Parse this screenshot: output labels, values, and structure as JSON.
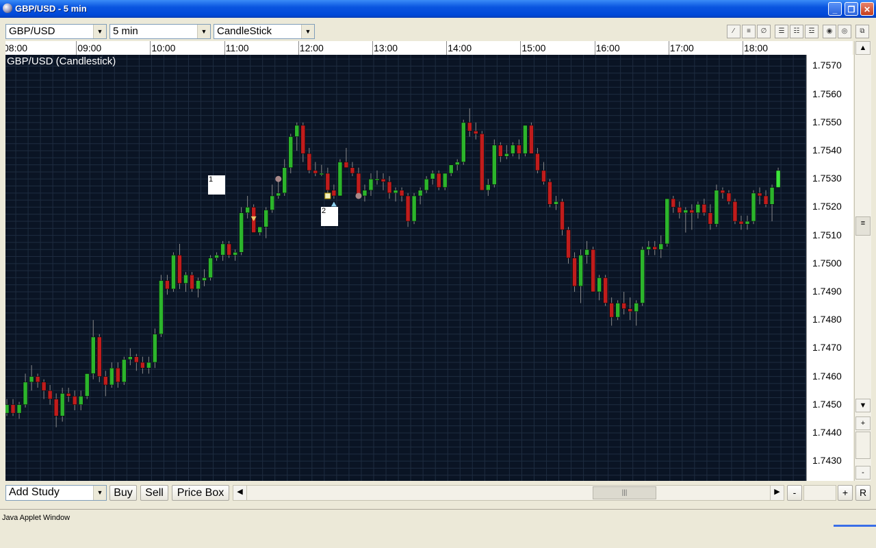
{
  "window": {
    "title": "GBP/USD - 5 min"
  },
  "toolbar": {
    "symbol": "GBP/USD",
    "interval": "5 min",
    "chart_type": "CandleStick"
  },
  "bottom": {
    "add_study": "Add Study",
    "buy": "Buy",
    "sell": "Sell",
    "price_box": "Price Box",
    "reset": "R",
    "zoom_out": "-",
    "zoom_in": "+"
  },
  "status": {
    "text": "Java Applet Window"
  },
  "notes": [
    "1",
    "2"
  ],
  "colors": {
    "background": "#0a1424",
    "up": "#2cb52c",
    "down": "#c01c1c",
    "grid": "#1e2c40"
  },
  "chart_data": {
    "type": "candlestick",
    "title": "GBP/USD (Candlestick)",
    "x_ticks": [
      "08:00",
      "09:00",
      "10:00",
      "11:00",
      "12:00",
      "13:00",
      "14:00",
      "15:00",
      "16:00",
      "17:00",
      "18:00"
    ],
    "y_ticks": [
      "1.7570",
      "1.7560",
      "1.7550",
      "1.7540",
      "1.7530",
      "1.7520",
      "1.7510",
      "1.7500",
      "1.7490",
      "1.7480",
      "1.7470",
      "1.7460",
      "1.7450",
      "1.7440",
      "1.7430"
    ],
    "ylim": [
      1.7423,
      1.7574
    ],
    "grid": true,
    "series": [
      {
        "time": "08:00",
        "open": 1.7447,
        "high": 1.7452,
        "low": 1.7446,
        "close": 1.745
      },
      {
        "time": "08:05",
        "open": 1.745,
        "high": 1.7452,
        "low": 1.7446,
        "close": 1.7447
      },
      {
        "time": "08:10",
        "open": 1.7447,
        "high": 1.7451,
        "low": 1.7445,
        "close": 1.745
      },
      {
        "time": "08:15",
        "open": 1.745,
        "high": 1.7461,
        "low": 1.7449,
        "close": 1.7458
      },
      {
        "time": "08:20",
        "open": 1.7458,
        "high": 1.7464,
        "low": 1.7455,
        "close": 1.746
      },
      {
        "time": "08:25",
        "open": 1.746,
        "high": 1.7461,
        "low": 1.7456,
        "close": 1.7458
      },
      {
        "time": "08:30",
        "open": 1.7458,
        "high": 1.7459,
        "low": 1.7452,
        "close": 1.7455
      },
      {
        "time": "08:35",
        "open": 1.7455,
        "high": 1.7457,
        "low": 1.745,
        "close": 1.7452
      },
      {
        "time": "08:40",
        "open": 1.7452,
        "high": 1.7454,
        "low": 1.7442,
        "close": 1.7446
      },
      {
        "time": "08:45",
        "open": 1.7446,
        "high": 1.7456,
        "low": 1.7444,
        "close": 1.7454
      },
      {
        "time": "08:50",
        "open": 1.7454,
        "high": 1.7456,
        "low": 1.7451,
        "close": 1.7453
      },
      {
        "time": "08:55",
        "open": 1.7453,
        "high": 1.7455,
        "low": 1.7448,
        "close": 1.745
      },
      {
        "time": "09:00",
        "open": 1.745,
        "high": 1.7455,
        "low": 1.7448,
        "close": 1.7453
      },
      {
        "time": "09:05",
        "open": 1.7453,
        "high": 1.7461,
        "low": 1.7452,
        "close": 1.7461
      },
      {
        "time": "09:10",
        "open": 1.7461,
        "high": 1.748,
        "low": 1.7459,
        "close": 1.7474
      },
      {
        "time": "09:15",
        "open": 1.7474,
        "high": 1.7475,
        "low": 1.7458,
        "close": 1.746
      },
      {
        "time": "09:20",
        "open": 1.746,
        "high": 1.7462,
        "low": 1.7453,
        "close": 1.7457
      },
      {
        "time": "09:25",
        "open": 1.7457,
        "high": 1.7465,
        "low": 1.7456,
        "close": 1.7463
      },
      {
        "time": "09:30",
        "open": 1.7463,
        "high": 1.7465,
        "low": 1.7456,
        "close": 1.7458
      },
      {
        "time": "09:35",
        "open": 1.7458,
        "high": 1.7467,
        "low": 1.7457,
        "close": 1.7466
      },
      {
        "time": "09:40",
        "open": 1.7466,
        "high": 1.747,
        "low": 1.7464,
        "close": 1.7467
      },
      {
        "time": "09:45",
        "open": 1.7467,
        "high": 1.7468,
        "low": 1.7462,
        "close": 1.7465
      },
      {
        "time": "09:50",
        "open": 1.7465,
        "high": 1.7467,
        "low": 1.7461,
        "close": 1.7463
      },
      {
        "time": "09:55",
        "open": 1.7463,
        "high": 1.7467,
        "low": 1.7461,
        "close": 1.7465
      },
      {
        "time": "10:00",
        "open": 1.7465,
        "high": 1.7477,
        "low": 1.7463,
        "close": 1.7475
      },
      {
        "time": "10:05",
        "open": 1.7475,
        "high": 1.7496,
        "low": 1.7474,
        "close": 1.7494
      },
      {
        "time": "10:10",
        "open": 1.7494,
        "high": 1.7496,
        "low": 1.7489,
        "close": 1.7491
      },
      {
        "time": "10:15",
        "open": 1.7491,
        "high": 1.7504,
        "low": 1.749,
        "close": 1.7503
      },
      {
        "time": "10:20",
        "open": 1.7503,
        "high": 1.7507,
        "low": 1.7491,
        "close": 1.7493
      },
      {
        "time": "10:25",
        "open": 1.7493,
        "high": 1.7497,
        "low": 1.749,
        "close": 1.7496
      },
      {
        "time": "10:30",
        "open": 1.7496,
        "high": 1.7497,
        "low": 1.749,
        "close": 1.7491
      },
      {
        "time": "10:35",
        "open": 1.7491,
        "high": 1.7495,
        "low": 1.7488,
        "close": 1.7494
      },
      {
        "time": "10:40",
        "open": 1.7494,
        "high": 1.7498,
        "low": 1.7492,
        "close": 1.7495
      },
      {
        "time": "10:45",
        "open": 1.7495,
        "high": 1.7503,
        "low": 1.7494,
        "close": 1.7502
      },
      {
        "time": "10:50",
        "open": 1.7502,
        "high": 1.7504,
        "low": 1.7501,
        "close": 1.7503
      },
      {
        "time": "10:55",
        "open": 1.7503,
        "high": 1.7508,
        "low": 1.7501,
        "close": 1.7507
      },
      {
        "time": "11:00",
        "open": 1.7507,
        "high": 1.7508,
        "low": 1.7502,
        "close": 1.7503
      },
      {
        "time": "11:05",
        "open": 1.7503,
        "high": 1.7505,
        "low": 1.7501,
        "close": 1.7504
      },
      {
        "time": "11:10",
        "open": 1.7504,
        "high": 1.752,
        "low": 1.7503,
        "close": 1.7518
      },
      {
        "time": "11:15",
        "open": 1.7518,
        "high": 1.7524,
        "low": 1.7516,
        "close": 1.752
      },
      {
        "time": "11:20",
        "open": 1.752,
        "high": 1.7521,
        "low": 1.7511,
        "close": 1.7511
      },
      {
        "time": "11:25",
        "open": 1.7511,
        "high": 1.7513,
        "low": 1.751,
        "close": 1.7513
      },
      {
        "time": "11:30",
        "open": 1.7513,
        "high": 1.752,
        "low": 1.7509,
        "close": 1.7519
      },
      {
        "time": "11:35",
        "open": 1.7519,
        "high": 1.7528,
        "low": 1.7518,
        "close": 1.7524
      },
      {
        "time": "11:40",
        "open": 1.7524,
        "high": 1.753,
        "low": 1.7523,
        "close": 1.7525
      },
      {
        "time": "11:45",
        "open": 1.7525,
        "high": 1.7537,
        "low": 1.7524,
        "close": 1.7534
      },
      {
        "time": "11:50",
        "open": 1.7534,
        "high": 1.7546,
        "low": 1.7532,
        "close": 1.7545
      },
      {
        "time": "11:55",
        "open": 1.7545,
        "high": 1.755,
        "low": 1.754,
        "close": 1.7549
      },
      {
        "time": "12:00",
        "open": 1.7549,
        "high": 1.755,
        "low": 1.7536,
        "close": 1.7539
      },
      {
        "time": "12:05",
        "open": 1.7539,
        "high": 1.7541,
        "low": 1.7532,
        "close": 1.7533
      },
      {
        "time": "12:10",
        "open": 1.7533,
        "high": 1.7536,
        "low": 1.7531,
        "close": 1.7532
      },
      {
        "time": "12:15",
        "open": 1.7532,
        "high": 1.7535,
        "low": 1.7531,
        "close": 1.7532
      },
      {
        "time": "12:20",
        "open": 1.7532,
        "high": 1.7534,
        "low": 1.7524,
        "close": 1.7526
      },
      {
        "time": "12:25",
        "open": 1.7526,
        "high": 1.7528,
        "low": 1.7523,
        "close": 1.7524
      },
      {
        "time": "12:30",
        "open": 1.7524,
        "high": 1.7537,
        "low": 1.7524,
        "close": 1.7536
      },
      {
        "time": "12:35",
        "open": 1.7536,
        "high": 1.7541,
        "low": 1.7534,
        "close": 1.7534
      },
      {
        "time": "12:40",
        "open": 1.7534,
        "high": 1.7536,
        "low": 1.7531,
        "close": 1.7532
      },
      {
        "time": "12:45",
        "open": 1.7532,
        "high": 1.7534,
        "low": 1.7523,
        "close": 1.7524
      },
      {
        "time": "12:50",
        "open": 1.7524,
        "high": 1.7528,
        "low": 1.7522,
        "close": 1.7526
      },
      {
        "time": "12:55",
        "open": 1.7526,
        "high": 1.7532,
        "low": 1.7524,
        "close": 1.753
      },
      {
        "time": "13:00",
        "open": 1.753,
        "high": 1.7533,
        "low": 1.7528,
        "close": 1.753
      },
      {
        "time": "13:05",
        "open": 1.753,
        "high": 1.7532,
        "low": 1.7526,
        "close": 1.7529
      },
      {
        "time": "13:10",
        "open": 1.7529,
        "high": 1.7531,
        "low": 1.7523,
        "close": 1.7525
      },
      {
        "time": "13:15",
        "open": 1.7525,
        "high": 1.7527,
        "low": 1.7522,
        "close": 1.7526
      },
      {
        "time": "13:20",
        "open": 1.7526,
        "high": 1.7527,
        "low": 1.7522,
        "close": 1.7524
      },
      {
        "time": "13:25",
        "open": 1.7524,
        "high": 1.7525,
        "low": 1.7513,
        "close": 1.7515
      },
      {
        "time": "13:30",
        "open": 1.7515,
        "high": 1.7525,
        "low": 1.7514,
        "close": 1.7524
      },
      {
        "time": "13:35",
        "open": 1.7524,
        "high": 1.7527,
        "low": 1.7521,
        "close": 1.7526
      },
      {
        "time": "13:40",
        "open": 1.7526,
        "high": 1.7531,
        "low": 1.7525,
        "close": 1.753
      },
      {
        "time": "13:45",
        "open": 1.753,
        "high": 1.7533,
        "low": 1.7528,
        "close": 1.7532
      },
      {
        "time": "13:50",
        "open": 1.7532,
        "high": 1.7533,
        "low": 1.7526,
        "close": 1.7527
      },
      {
        "time": "13:55",
        "open": 1.7527,
        "high": 1.7532,
        "low": 1.7526,
        "close": 1.7532
      },
      {
        "time": "14:00",
        "open": 1.7532,
        "high": 1.7535,
        "low": 1.7531,
        "close": 1.7535
      },
      {
        "time": "14:05",
        "open": 1.7535,
        "high": 1.7537,
        "low": 1.7533,
        "close": 1.7536
      },
      {
        "time": "14:10",
        "open": 1.7536,
        "high": 1.7551,
        "low": 1.7535,
        "close": 1.755
      },
      {
        "time": "14:15",
        "open": 1.755,
        "high": 1.7555,
        "low": 1.7545,
        "close": 1.7547
      },
      {
        "time": "14:20",
        "open": 1.7547,
        "high": 1.755,
        "low": 1.7544,
        "close": 1.7546
      },
      {
        "time": "14:25",
        "open": 1.7546,
        "high": 1.7547,
        "low": 1.7526,
        "close": 1.7526
      },
      {
        "time": "14:30",
        "open": 1.7526,
        "high": 1.753,
        "low": 1.7524,
        "close": 1.7528
      },
      {
        "time": "14:35",
        "open": 1.7528,
        "high": 1.7544,
        "low": 1.7527,
        "close": 1.7542
      },
      {
        "time": "14:40",
        "open": 1.7542,
        "high": 1.7543,
        "low": 1.7536,
        "close": 1.7538
      },
      {
        "time": "14:45",
        "open": 1.7538,
        "high": 1.7542,
        "low": 1.7537,
        "close": 1.7539
      },
      {
        "time": "14:50",
        "open": 1.7539,
        "high": 1.7543,
        "low": 1.7538,
        "close": 1.7542
      },
      {
        "time": "14:55",
        "open": 1.7542,
        "high": 1.7544,
        "low": 1.7537,
        "close": 1.7539
      },
      {
        "time": "15:00",
        "open": 1.7539,
        "high": 1.7549,
        "low": 1.7538,
        "close": 1.7549
      },
      {
        "time": "15:05",
        "open": 1.7549,
        "high": 1.755,
        "low": 1.7539,
        "close": 1.7539
      },
      {
        "time": "15:10",
        "open": 1.7539,
        "high": 1.7541,
        "low": 1.7532,
        "close": 1.7533
      },
      {
        "time": "15:15",
        "open": 1.7533,
        "high": 1.7536,
        "low": 1.7528,
        "close": 1.7529
      },
      {
        "time": "15:20",
        "open": 1.7529,
        "high": 1.753,
        "low": 1.752,
        "close": 1.7521
      },
      {
        "time": "15:25",
        "open": 1.7521,
        "high": 1.7524,
        "low": 1.7519,
        "close": 1.7522
      },
      {
        "time": "15:30",
        "open": 1.7522,
        "high": 1.7523,
        "low": 1.751,
        "close": 1.7512
      },
      {
        "time": "15:35",
        "open": 1.7512,
        "high": 1.7513,
        "low": 1.75,
        "close": 1.7502
      },
      {
        "time": "15:40",
        "open": 1.7502,
        "high": 1.7504,
        "low": 1.749,
        "close": 1.7492
      },
      {
        "time": "15:45",
        "open": 1.7492,
        "high": 1.7505,
        "low": 1.7486,
        "close": 1.7503
      },
      {
        "time": "15:50",
        "open": 1.7503,
        "high": 1.7508,
        "low": 1.75,
        "close": 1.7505
      },
      {
        "time": "15:55",
        "open": 1.7505,
        "high": 1.7506,
        "low": 1.749,
        "close": 1.749
      },
      {
        "time": "16:00",
        "open": 1.749,
        "high": 1.7496,
        "low": 1.7487,
        "close": 1.7495
      },
      {
        "time": "16:05",
        "open": 1.7495,
        "high": 1.7496,
        "low": 1.7485,
        "close": 1.7486
      },
      {
        "time": "16:10",
        "open": 1.7486,
        "high": 1.7488,
        "low": 1.7478,
        "close": 1.7481
      },
      {
        "time": "16:15",
        "open": 1.7481,
        "high": 1.7487,
        "low": 1.748,
        "close": 1.7486
      },
      {
        "time": "16:20",
        "open": 1.7486,
        "high": 1.749,
        "low": 1.7482,
        "close": 1.7484
      },
      {
        "time": "16:25",
        "open": 1.7484,
        "high": 1.7488,
        "low": 1.748,
        "close": 1.7483
      },
      {
        "time": "16:30",
        "open": 1.7483,
        "high": 1.7487,
        "low": 1.7478,
        "close": 1.7486
      },
      {
        "time": "16:35",
        "open": 1.7486,
        "high": 1.7506,
        "low": 1.7485,
        "close": 1.7505
      },
      {
        "time": "16:40",
        "open": 1.7505,
        "high": 1.7508,
        "low": 1.7503,
        "close": 1.7506
      },
      {
        "time": "16:45",
        "open": 1.7506,
        "high": 1.7508,
        "low": 1.7503,
        "close": 1.7505
      },
      {
        "time": "16:50",
        "open": 1.7505,
        "high": 1.751,
        "low": 1.7502,
        "close": 1.7507
      },
      {
        "time": "16:55",
        "open": 1.7507,
        "high": 1.7523,
        "low": 1.7506,
        "close": 1.7523
      },
      {
        "time": "17:00",
        "open": 1.7523,
        "high": 1.7524,
        "low": 1.7518,
        "close": 1.752
      },
      {
        "time": "17:05",
        "open": 1.752,
        "high": 1.7522,
        "low": 1.7516,
        "close": 1.7518
      },
      {
        "time": "17:10",
        "open": 1.7518,
        "high": 1.752,
        "low": 1.7511,
        "close": 1.7519
      },
      {
        "time": "17:15",
        "open": 1.7519,
        "high": 1.7521,
        "low": 1.7512,
        "close": 1.7518
      },
      {
        "time": "17:20",
        "open": 1.7518,
        "high": 1.7522,
        "low": 1.7516,
        "close": 1.7521
      },
      {
        "time": "17:25",
        "open": 1.7521,
        "high": 1.7523,
        "low": 1.7517,
        "close": 1.7518
      },
      {
        "time": "17:30",
        "open": 1.7518,
        "high": 1.7521,
        "low": 1.7512,
        "close": 1.7514
      },
      {
        "time": "17:35",
        "open": 1.7514,
        "high": 1.7528,
        "low": 1.7513,
        "close": 1.7526
      },
      {
        "time": "17:40",
        "open": 1.7526,
        "high": 1.7527,
        "low": 1.7523,
        "close": 1.7525
      },
      {
        "time": "17:45",
        "open": 1.7525,
        "high": 1.7526,
        "low": 1.7521,
        "close": 1.7522
      },
      {
        "time": "17:50",
        "open": 1.7522,
        "high": 1.7523,
        "low": 1.7514,
        "close": 1.7515
      },
      {
        "time": "17:55",
        "open": 1.7515,
        "high": 1.7517,
        "low": 1.7512,
        "close": 1.7514
      },
      {
        "time": "18:00",
        "open": 1.7514,
        "high": 1.7517,
        "low": 1.7512,
        "close": 1.7515
      },
      {
        "time": "18:05",
        "open": 1.7515,
        "high": 1.7526,
        "low": 1.7514,
        "close": 1.7525
      },
      {
        "time": "18:10",
        "open": 1.7525,
        "high": 1.7527,
        "low": 1.7521,
        "close": 1.7524
      },
      {
        "time": "18:15",
        "open": 1.7524,
        "high": 1.7526,
        "low": 1.752,
        "close": 1.7521
      },
      {
        "time": "18:20",
        "open": 1.7521,
        "high": 1.7528,
        "low": 1.7515,
        "close": 1.7527
      },
      {
        "time": "18:25",
        "open": 1.7527,
        "high": 1.7534,
        "low": 1.7527,
        "close": 1.7533
      }
    ]
  }
}
